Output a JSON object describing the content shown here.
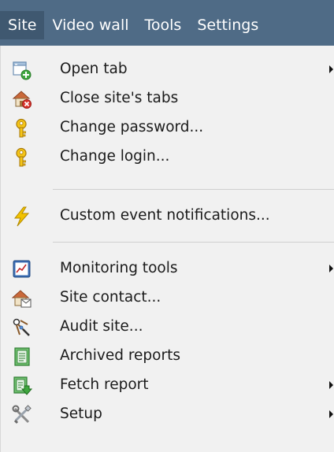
{
  "menubar": {
    "items": [
      {
        "label": "Site"
      },
      {
        "label": "Video wall"
      },
      {
        "label": "Tools"
      },
      {
        "label": "Settings"
      }
    ]
  },
  "menu": {
    "items": [
      {
        "label": "Open tab",
        "icon": "open-tab-icon",
        "submenu": true
      },
      {
        "label": "Close site's tabs",
        "icon": "close-site-tabs-icon",
        "submenu": false
      },
      {
        "label": "Change password...",
        "icon": "key-icon",
        "submenu": false
      },
      {
        "label": "Change login...",
        "icon": "key-icon",
        "submenu": false
      },
      {
        "label": "Custom event notifications...",
        "icon": "lightning-icon",
        "submenu": false
      },
      {
        "label": "Monitoring tools",
        "icon": "monitoring-chart-icon",
        "submenu": true
      },
      {
        "label": "Site contact...",
        "icon": "site-contact-icon",
        "submenu": false
      },
      {
        "label": "Audit site...",
        "icon": "audit-icon",
        "submenu": false
      },
      {
        "label": "Archived reports",
        "icon": "archived-reports-icon",
        "submenu": false
      },
      {
        "label": "Fetch report",
        "icon": "fetch-report-icon",
        "submenu": true
      },
      {
        "label": "Setup",
        "icon": "setup-tools-icon",
        "submenu": true
      }
    ]
  },
  "colors": {
    "menubar_bg": "#4f6b86",
    "menubar_active": "#3f5870",
    "menu_bg": "#f1f1f1",
    "key_yellow": "#f5c518",
    "lightning_yellow": "#f2c200"
  }
}
